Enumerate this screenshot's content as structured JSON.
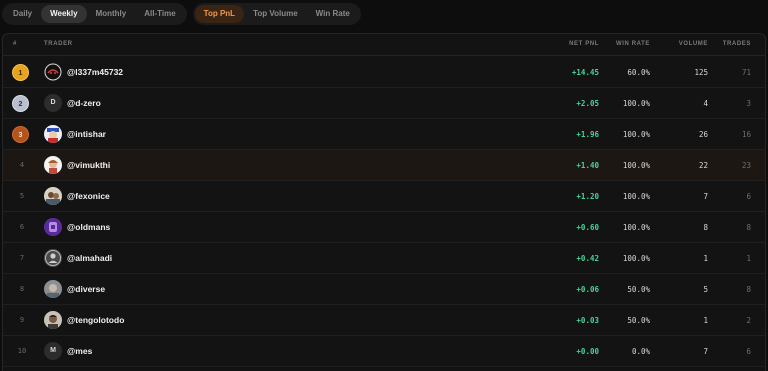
{
  "period_tabs": [
    {
      "label": "Daily",
      "active": false
    },
    {
      "label": "Weekly",
      "active": true
    },
    {
      "label": "Monthly",
      "active": false
    },
    {
      "label": "All-Time",
      "active": false
    }
  ],
  "metric_tabs": [
    {
      "label": "Top PnL",
      "active": true
    },
    {
      "label": "Top Volume",
      "active": false
    },
    {
      "label": "Win Rate",
      "active": false
    }
  ],
  "columns": {
    "rank": "#",
    "trader": "TRADER",
    "net_pnl": "NET PNL",
    "win_rate": "WIN RATE",
    "volume": "VOLUME",
    "trades": "TRADES"
  },
  "rows": [
    {
      "rank": "1",
      "name": "@l337m45732",
      "avatar": "",
      "pnl": "+14.45",
      "win_rate": "60.0%",
      "volume": "125",
      "trades": "71"
    },
    {
      "rank": "2",
      "name": "@d-zero",
      "avatar": "D",
      "pnl": "+2.05",
      "win_rate": "100.0%",
      "volume": "4",
      "trades": "3"
    },
    {
      "rank": "3",
      "name": "@intishar",
      "avatar": "",
      "pnl": "+1.96",
      "win_rate": "100.0%",
      "volume": "26",
      "trades": "16"
    },
    {
      "rank": "4",
      "name": "@vimukthi",
      "avatar": "",
      "pnl": "+1.40",
      "win_rate": "100.0%",
      "volume": "22",
      "trades": "23"
    },
    {
      "rank": "5",
      "name": "@fexonice",
      "avatar": "",
      "pnl": "+1.20",
      "win_rate": "100.0%",
      "volume": "7",
      "trades": "6"
    },
    {
      "rank": "6",
      "name": "@oldmans",
      "avatar": "",
      "pnl": "+0.60",
      "win_rate": "100.0%",
      "volume": "8",
      "trades": "8"
    },
    {
      "rank": "7",
      "name": "@almahadi",
      "avatar": "",
      "pnl": "+0.42",
      "win_rate": "100.0%",
      "volume": "1",
      "trades": "1"
    },
    {
      "rank": "8",
      "name": "@diverse",
      "avatar": "",
      "pnl": "+0.06",
      "win_rate": "50.0%",
      "volume": "5",
      "trades": "8"
    },
    {
      "rank": "9",
      "name": "@tengolotodo",
      "avatar": "",
      "pnl": "+0.03",
      "win_rate": "50.0%",
      "volume": "1",
      "trades": "2"
    },
    {
      "rank": "10",
      "name": "@mes",
      "avatar": "M",
      "pnl": "+0.00",
      "win_rate": "0.0%",
      "volume": "7",
      "trades": "6"
    }
  ],
  "colors": {
    "accent_orange": "#f39a4a",
    "pnl_green": "#46d39a",
    "gold": "#e9a21f",
    "silver": "#b8bfcf",
    "bronze": "#b5531b"
  }
}
